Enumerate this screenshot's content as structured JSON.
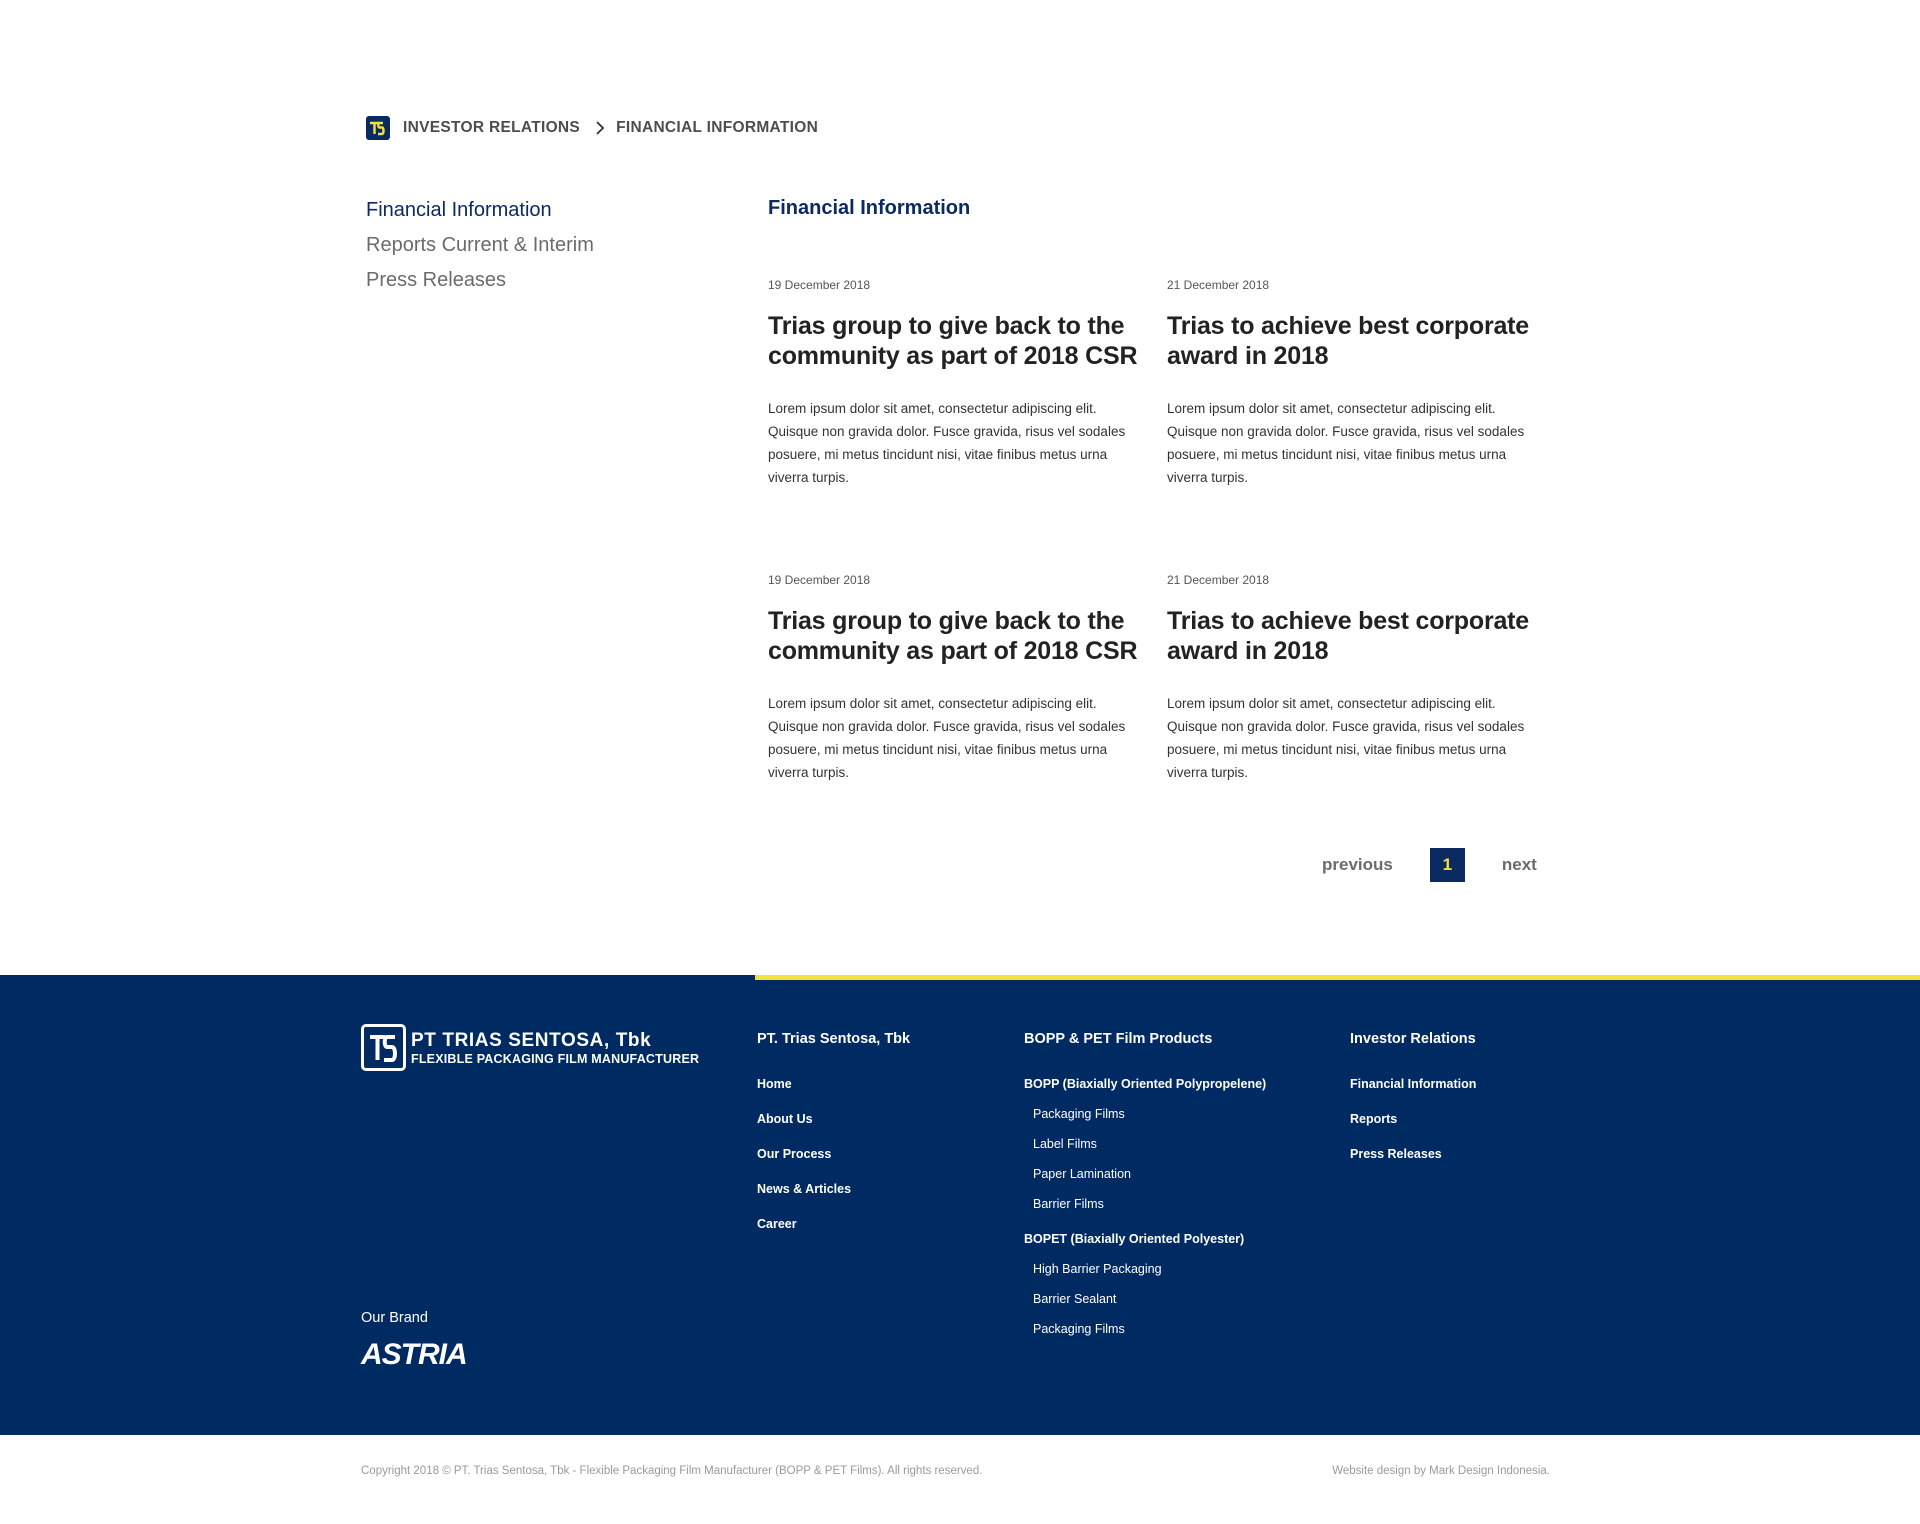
{
  "breadcrumb": {
    "items": [
      "INVESTOR RELATIONS",
      "FINANCIAL INFORMATION"
    ]
  },
  "sidebar": {
    "items": [
      {
        "label": "Financial Information",
        "active": true
      },
      {
        "label": "Reports Current & Interim",
        "active": false
      },
      {
        "label": "Press Releases",
        "active": false
      }
    ]
  },
  "main": {
    "title": "Financial Information",
    "articles": [
      {
        "date": "19 December 2018",
        "title": "Trias group to give back to the community as part of 2018 CSR",
        "body": "Lorem ipsum dolor sit amet, consectetur adipiscing elit. Quisque non gravida dolor. Fusce gravida, risus vel sodales posuere, mi metus tincidunt nisi, vitae finibus metus urna viverra turpis."
      },
      {
        "date": "21 December 2018",
        "title": "Trias to achieve best corporate award in 2018",
        "body": "Lorem ipsum dolor sit amet, consectetur adipiscing elit. Quisque non gravida dolor. Fusce gravida, risus vel sodales posuere, mi metus tincidunt nisi, vitae finibus metus urna viverra turpis."
      },
      {
        "date": "19 December 2018",
        "title": "Trias group to give back to the community as part of 2018 CSR",
        "body": "Lorem ipsum dolor sit amet, consectetur adipiscing elit. Quisque non gravida dolor. Fusce gravida, risus vel sodales posuere, mi metus tincidunt nisi, vitae finibus metus urna viverra turpis."
      },
      {
        "date": "21 December 2018",
        "title": "Trias to achieve best corporate award in 2018",
        "body": "Lorem ipsum dolor sit amet, consectetur adipiscing elit. Quisque non gravida dolor. Fusce gravida, risus vel sodales posuere, mi metus tincidunt nisi, vitae finibus metus urna viverra turpis."
      }
    ]
  },
  "pagination": {
    "previous": "previous",
    "current": "1",
    "next": "next"
  },
  "footer": {
    "logo_title": "PT TRIAS SENTOSA, Tbk",
    "logo_subtitle": "FLEXIBLE PACKAGING FILM MANUFACTURER",
    "brand_label": "Our Brand",
    "brand_name": "ASTRIA",
    "col1": {
      "head": "PT. Trias Sentosa, Tbk",
      "links": [
        "Home",
        "About Us",
        "Our Process",
        "News & Articles",
        "Career"
      ]
    },
    "col2": {
      "head": "BOPP & PET Film Products",
      "group1": "BOPP (Biaxially Oriented Polypropelene)",
      "group1_items": [
        "Packaging Films",
        "Label Films",
        "Paper Lamination",
        "Barrier Films"
      ],
      "group2": "BOPET (Biaxially Oriented Polyester)",
      "group2_items": [
        "High Barrier Packaging",
        "Barrier Sealant",
        "Packaging Films"
      ]
    },
    "col3": {
      "head": "Investor Relations",
      "links": [
        "Financial Information",
        "Reports",
        "Press Releases"
      ]
    },
    "copyright": "Copyright 2018 © PT. Trias Sentosa, Tbk - Flexible Packaging Film Manufacturer (BOPP & PET Films). All rights reserved.",
    "credit": "Website design by Mark Design Indonesia."
  },
  "colors": {
    "navy": "#002a62",
    "accent_yellow": "#f2e23a"
  }
}
